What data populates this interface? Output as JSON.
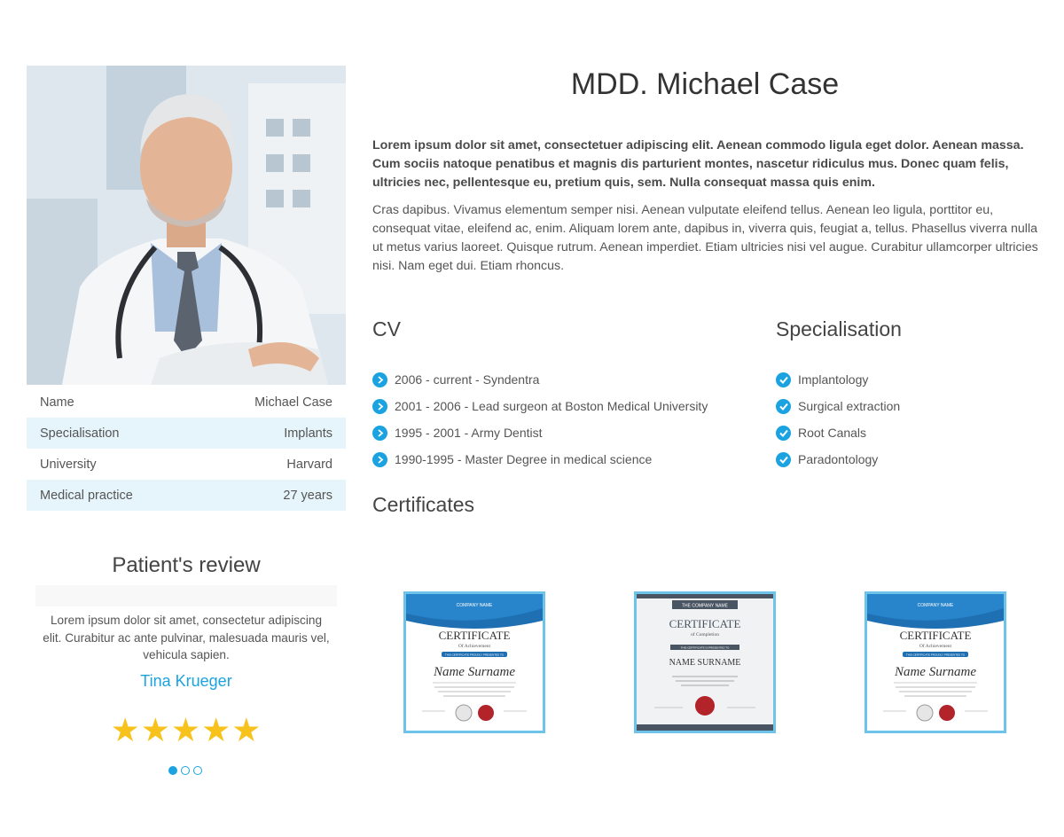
{
  "doctor": {
    "name": "MDD. Michael Case",
    "lead": "Lorem ipsum dolor sit amet, consectetuer adipiscing elit. Aenean commodo ligula eget dolor. Aenean massa. Cum sociis natoque penatibus et magnis dis parturient montes, nascetur ridiculus mus. Donec quam felis, ultricies nec, pellentesque eu, pretium quis, sem. Nulla consequat massa quis enim.",
    "body": "Cras dapibus. Vivamus elementum semper nisi. Aenean vulputate eleifend tellus. Aenean leo ligula, porttitor eu, consequat vitae, eleifend ac, enim. Aliquam lorem ante, dapibus in, viverra quis, feugiat a, tellus. Phasellus viverra nulla ut metus varius laoreet. Quisque rutrum. Aenean imperdiet. Etiam ultricies nisi vel augue. Curabitur ullamcorper ultricies nisi. Nam eget dui. Etiam rhoncus."
  },
  "info": [
    {
      "label": "Name",
      "value": "Michael Case"
    },
    {
      "label": "Specialisation",
      "value": "Implants"
    },
    {
      "label": "University",
      "value": "Harvard"
    },
    {
      "label": "Medical practice",
      "value": "27 years"
    }
  ],
  "cv": {
    "title": "CV",
    "items": [
      "2006 - current - Syndentra",
      "2001 - 2006 - Lead surgeon at Boston Medical University",
      "1995 - 2001 - Army Dentist",
      "1990-1995 - Master Degree in medical science"
    ]
  },
  "specialisation": {
    "title": "Specialisation",
    "items": [
      "Implantology",
      "Surgical extraction",
      "Root Canals",
      "Paradontology"
    ]
  },
  "certificates": {
    "title": "Certificates",
    "items": [
      {
        "company": "COMPANY NAME",
        "title": "CERTIFICATE",
        "subtitle": "Of Achievement",
        "ribbon": "THIS CERTIFICATE PROUDLY PRESENTED TO",
        "name": "Name Surname"
      },
      {
        "company": "THE COMPANY NAME",
        "title": "CERTIFICATE",
        "subtitle": "of Completion",
        "ribbon": "THIS CERTIFICATE IS PRESENTED TO",
        "name": "NAME SURNAME"
      },
      {
        "company": "COMPANY NAME",
        "title": "CERTIFICATE",
        "subtitle": "Of Achievement",
        "ribbon": "THIS CERTIFICATE PROUDLY PRESENTED TO",
        "name": "Name Surname"
      }
    ]
  },
  "review": {
    "title": "Patient's review",
    "text": "Lorem ipsum dolor sit amet, consectetur adipiscing elit. Curabitur ac ante pulvinar, malesuada mauris vel, vehicula sapien.",
    "author": "Tina Krueger",
    "stars": "★★★★★",
    "rating": 5,
    "slide_count": 3,
    "active_slide": 1
  },
  "colors": {
    "accent": "#1aa3e0",
    "row_alt": "#e6f5fb",
    "star": "#f8c21c",
    "cert_border": "#6ec3ea"
  }
}
